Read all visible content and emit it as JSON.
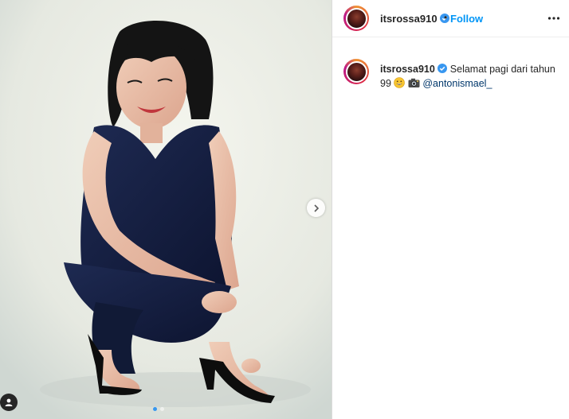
{
  "post": {
    "photo_icon": "photo-of-woman-in-black-outfit",
    "next_icon": "chevron-right-icon",
    "carousel": {
      "count": 2,
      "active": 0
    },
    "tag_icon": "user-tag-icon"
  },
  "header": {
    "username": "itsrossa910",
    "verified_icon": "verified-badge-icon",
    "separator": "•",
    "follow_label": "Follow",
    "more_icon": "more-options-icon"
  },
  "caption": {
    "username": "itsrossa910",
    "text_part1": "Selamat pagi dari tahun 99",
    "emoji1": "grinning-face-icon",
    "emoji2": "camera-icon",
    "mention": "@antonismael_"
  },
  "colors": {
    "link": "#0095f6",
    "mention": "#00376b",
    "text": "#262626",
    "divider": "#dbdbdb"
  }
}
